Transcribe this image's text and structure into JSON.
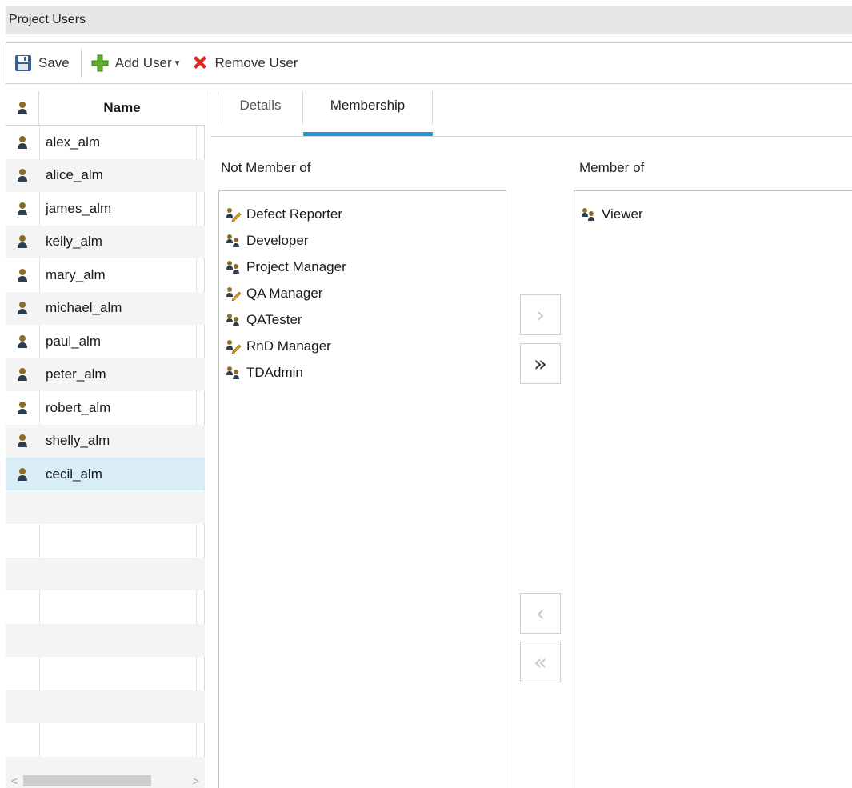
{
  "window": {
    "title": "Project Users"
  },
  "toolbar": {
    "save_label": "Save",
    "add_user_label": "Add User",
    "remove_user_label": "Remove User",
    "icons": {
      "save": "save-icon",
      "add": "add-user-icon",
      "remove": "remove-icon"
    },
    "colors": {
      "add": "#5cae2b",
      "remove": "#e0271b"
    }
  },
  "user_list": {
    "header": {
      "name_label": "Name"
    },
    "users": [
      {
        "name": "alex_alm"
      },
      {
        "name": "alice_alm"
      },
      {
        "name": "james_alm"
      },
      {
        "name": "kelly_alm"
      },
      {
        "name": "mary_alm"
      },
      {
        "name": "michael_alm"
      },
      {
        "name": "paul_alm"
      },
      {
        "name": "peter_alm"
      },
      {
        "name": "robert_alm"
      },
      {
        "name": "shelly_alm"
      },
      {
        "name": "cecil_alm"
      }
    ],
    "selected": "cecil_alm",
    "selected_color": "#d9edf8"
  },
  "tabs": [
    {
      "label": "Details",
      "active": false
    },
    {
      "label": "Membership",
      "active": true
    }
  ],
  "tab_accent": "#1b9ad6",
  "membership": {
    "not_member_label": "Not Member of",
    "member_label": "Member of",
    "not_member_groups": [
      {
        "name": "Defect Reporter",
        "icon": "custom-group-icon"
      },
      {
        "name": "Developer",
        "icon": "group-icon"
      },
      {
        "name": "Project Manager",
        "icon": "group-icon"
      },
      {
        "name": "QA Manager",
        "icon": "custom-group-icon"
      },
      {
        "name": "QATester",
        "icon": "group-icon"
      },
      {
        "name": "RnD Manager",
        "icon": "custom-group-icon"
      },
      {
        "name": "TDAdmin",
        "icon": "group-icon"
      }
    ],
    "member_groups": [
      {
        "name": "Viewer",
        "icon": "group-icon"
      }
    ],
    "buttons": {
      "add_one": {
        "glyph": "›",
        "enabled": false
      },
      "add_all": {
        "glyph": "»",
        "enabled": true
      },
      "remove_one": {
        "glyph": "‹",
        "enabled": false
      },
      "remove_all": {
        "glyph": "«",
        "enabled": false
      }
    }
  }
}
